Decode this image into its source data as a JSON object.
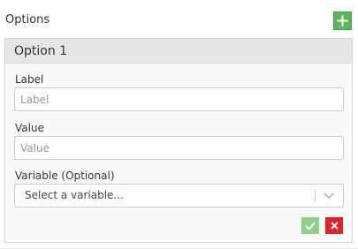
{
  "options": {
    "title": "Options",
    "add_icon": "plus-icon"
  },
  "option_panel": {
    "title": "Option 1",
    "label_field": {
      "label": "Label",
      "value": "",
      "placeholder": "Label"
    },
    "value_field": {
      "label": "Value",
      "value": "",
      "placeholder": "Value"
    },
    "variable_field": {
      "label": "Variable (Optional)",
      "selected": "Select a variable...",
      "icon": "chevron-down-icon"
    },
    "confirm_icon": "check-icon",
    "cancel_icon": "close-icon"
  },
  "colors": {
    "add_button": "#5cb85c",
    "confirm_button": "#8fcf8a",
    "cancel_button": "#d9232d"
  }
}
